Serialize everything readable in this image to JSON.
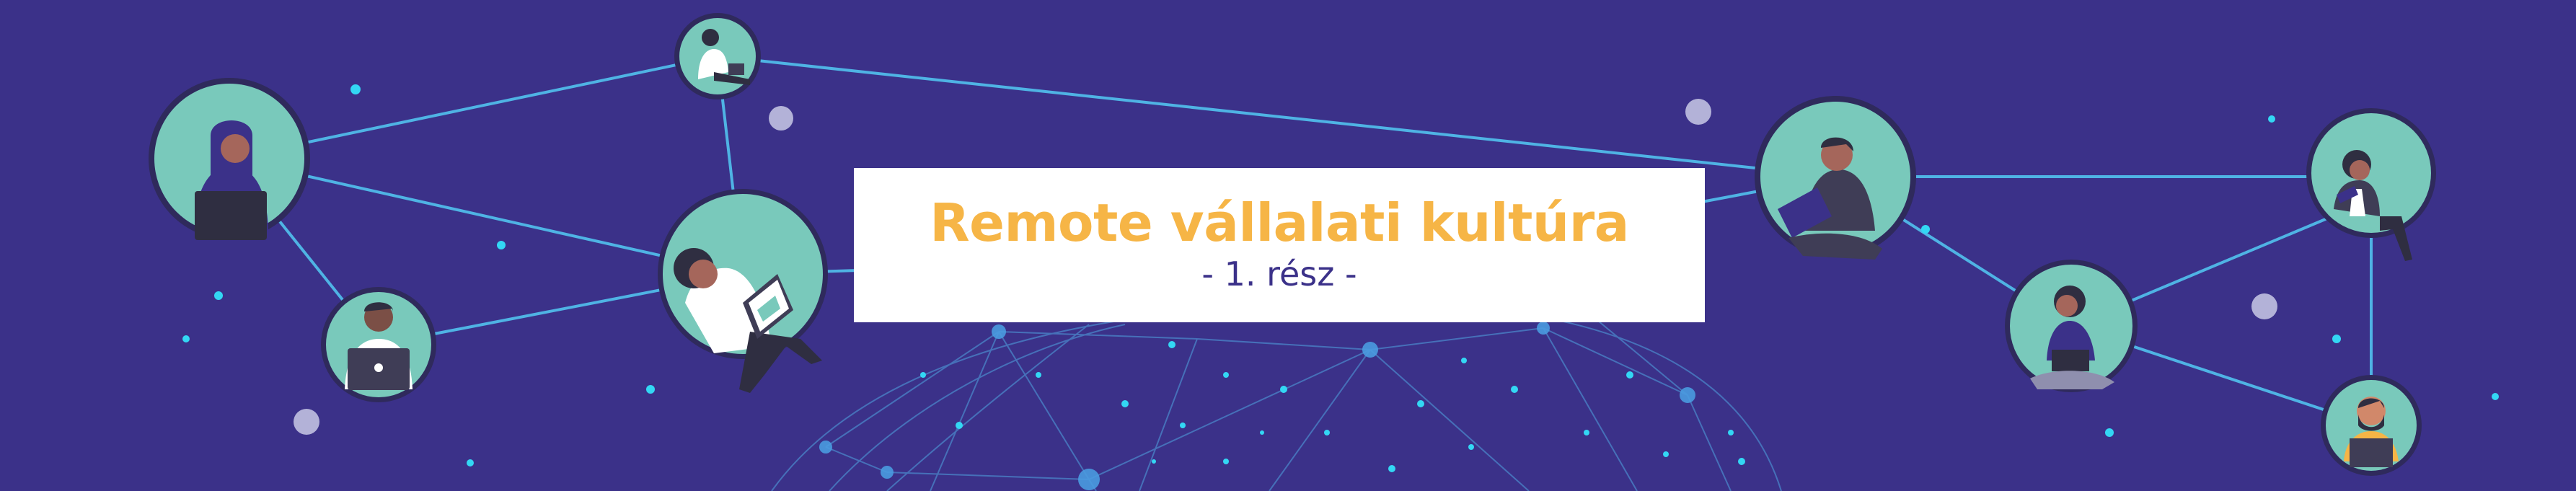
{
  "banner": {
    "title": "Remote vállalati kultúra",
    "subtitle": "- 1. rész -"
  },
  "colors": {
    "background": "#3b3189",
    "title": "#f6b546",
    "subtitle": "#3b3189",
    "card": "#ffffff",
    "avatar_circle": "#79c9bb",
    "avatar_ring": "#2f2a5c",
    "network_line": "#4fb3e4",
    "globe_line": "#4a86c9",
    "dot_bright": "#33d7f4",
    "dot_pale": "#b3b2d8"
  },
  "icons": [
    "person-with-laptop-avatar",
    "person-reading-tablet-avatar",
    "person-with-mug-avatar",
    "globe-network-graphic"
  ]
}
